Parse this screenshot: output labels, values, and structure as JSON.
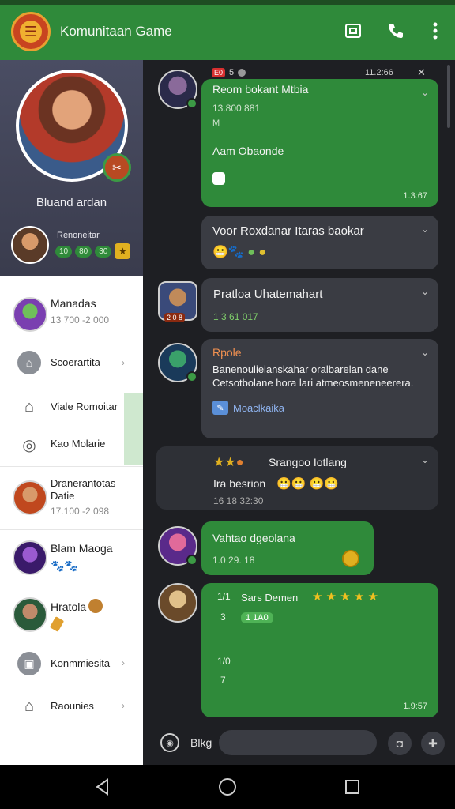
{
  "app": {
    "title": "Komunitaan Game",
    "icons": [
      "screen-share-icon",
      "phone-icon",
      "more-vertical-icon"
    ]
  },
  "profile": {
    "name": "Bluand ardan",
    "mini_title": "Renoneitar",
    "mini_stats": [
      "10",
      "80",
      "30"
    ],
    "star": "★"
  },
  "sidebar": {
    "items": [
      {
        "type": "contact",
        "title": "Manadas",
        "sub": "13 700 -2 000"
      },
      {
        "type": "menu",
        "title": "Scoerartita",
        "icon": "store-icon"
      },
      {
        "type": "menu",
        "title": "Viale Romoitar",
        "icon": "home-icon"
      },
      {
        "type": "menu",
        "title": "Kao Molarie",
        "icon": "camera-icon"
      },
      {
        "type": "contact",
        "title": "Dranerantotas Datie",
        "sub": "17.100 -2 098"
      },
      {
        "type": "contact",
        "title": "Blam Maoga",
        "sub": ""
      },
      {
        "type": "contact",
        "title": "Hratola",
        "sub": ""
      },
      {
        "type": "menu",
        "title": "Konmmiesita",
        "icon": "gift-icon"
      },
      {
        "type": "menu",
        "title": "Raounies",
        "icon": "house-icon"
      }
    ]
  },
  "chat": {
    "header": {
      "tags": [
        "E0",
        "5"
      ],
      "time": "11.2:66"
    },
    "messages": [
      {
        "bubble": "green",
        "title": "Reom bokant Mtbia",
        "line1": "13.800 881",
        "line2": "Aam Obaonde",
        "time": "1.3:67"
      },
      {
        "bubble": "dark",
        "title": "Voor Roxdanar Itaras baokar"
      },
      {
        "bubble": "dark",
        "title": "Pratloa Uhatemahart",
        "sub": "1 3 61 017"
      },
      {
        "bubble": "dark",
        "title": "Rpole",
        "body": "Banenoulieianskahar oralbarelan dane Cetsotbolane hora lari atmeosmeneneerera.",
        "link": "Moaclkaika"
      },
      {
        "bubble": "dark",
        "title": "Srangoo Iotlang",
        "line1": "Ira besrion",
        "time": "16 18 32:30"
      },
      {
        "bubble": "green",
        "title": "Vahtao dgeolana",
        "time": "1.0 29. 18"
      },
      {
        "bubble": "green",
        "title": "Sars Demen",
        "chip": "1 1A0",
        "left_marks": [
          "1/1",
          "3",
          "1/0",
          "7"
        ],
        "time": "1.9:57"
      }
    ]
  },
  "input": {
    "label": "Blkg",
    "placeholder": ""
  },
  "colors": {
    "brand_green": "#2f8a3a",
    "bubble_dark": "#3a3c43",
    "background": "#1e1f23"
  },
  "nav": [
    "back-icon",
    "home-icon",
    "recents-icon"
  ]
}
